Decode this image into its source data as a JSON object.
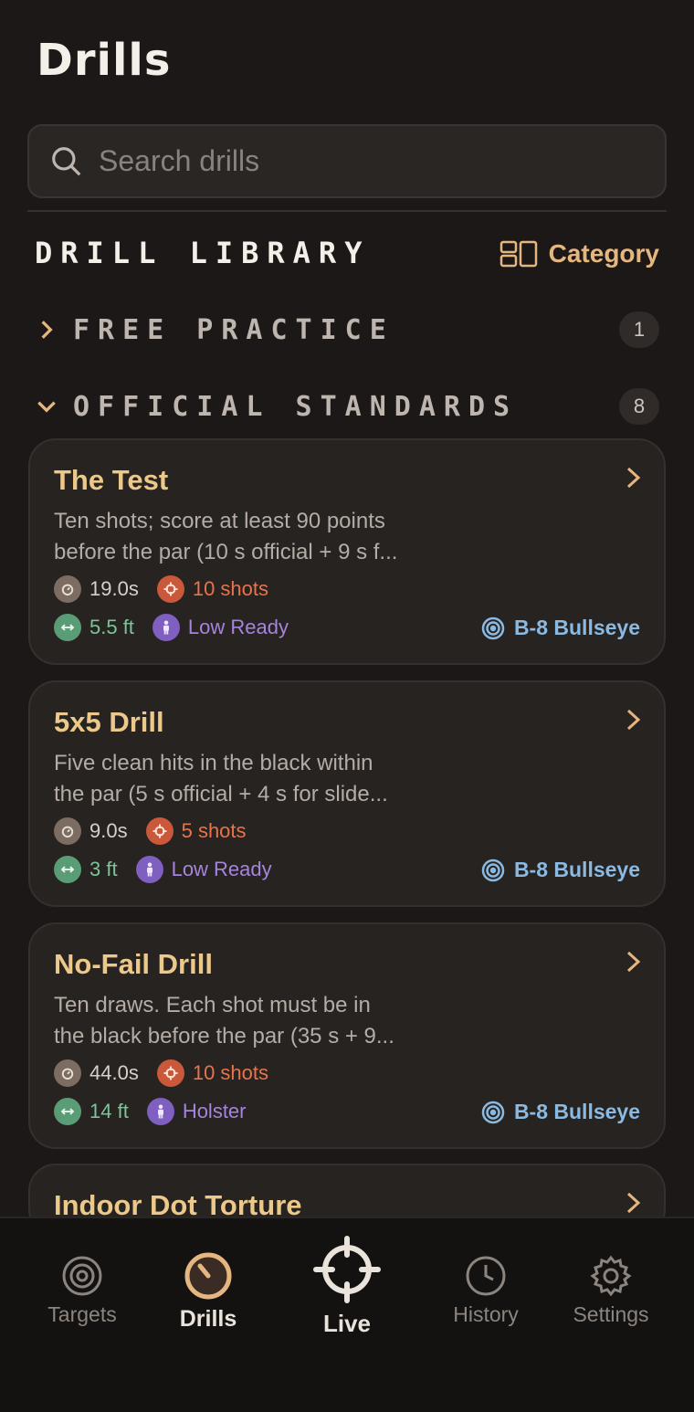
{
  "header": {
    "title": "Drills"
  },
  "search": {
    "placeholder": "Search drills"
  },
  "library": {
    "title": "DRILL LIBRARY",
    "category_label": "Category"
  },
  "sections": [
    {
      "label": "FREE PRACTICE",
      "count": "1",
      "expanded": false
    },
    {
      "label": "OFFICIAL STANDARDS",
      "count": "8",
      "expanded": true
    }
  ],
  "drills": [
    {
      "name": "The Test",
      "desc_line1": "Ten shots; score at least 90 points",
      "desc_line2": "before the par (10 s official + 9 s f...",
      "time": "19.0s",
      "shots": "10 shots",
      "distance": "5.5 ft",
      "position": "Low Ready",
      "target": "B-8 Bullseye"
    },
    {
      "name": "5x5 Drill",
      "desc_line1": "Five clean hits in the black within",
      "desc_line2": "the par (5 s official + 4 s for slide...",
      "time": "9.0s",
      "shots": "5 shots",
      "distance": "3 ft",
      "position": "Low Ready",
      "target": "B-8 Bullseye"
    },
    {
      "name": "No-Fail Drill",
      "desc_line1": "Ten draws. Each shot must be in",
      "desc_line2": "the black before the par (35 s + 9...",
      "time": "44.0s",
      "shots": "10 shots",
      "distance": "14 ft",
      "position": "Holster",
      "target": "B-8 Bullseye"
    },
    {
      "name": "Indoor Dot Torture"
    }
  ],
  "tabs": [
    {
      "label": "Targets",
      "icon": "target-icon"
    },
    {
      "label": "Drills",
      "icon": "timer-icon",
      "active": true
    },
    {
      "label": "Live",
      "icon": "crosshair-icon"
    },
    {
      "label": "History",
      "icon": "clock-icon"
    },
    {
      "label": "Settings",
      "icon": "gear-icon"
    }
  ],
  "colors": {
    "background": "#1b1817",
    "accent_gold": "#ecc98a",
    "accent_orange": "#e6b680",
    "shots_red": "#e9734c",
    "distance_green": "#7cc49a",
    "position_purple": "#a585dc",
    "target_blue": "#8ab9e2"
  }
}
